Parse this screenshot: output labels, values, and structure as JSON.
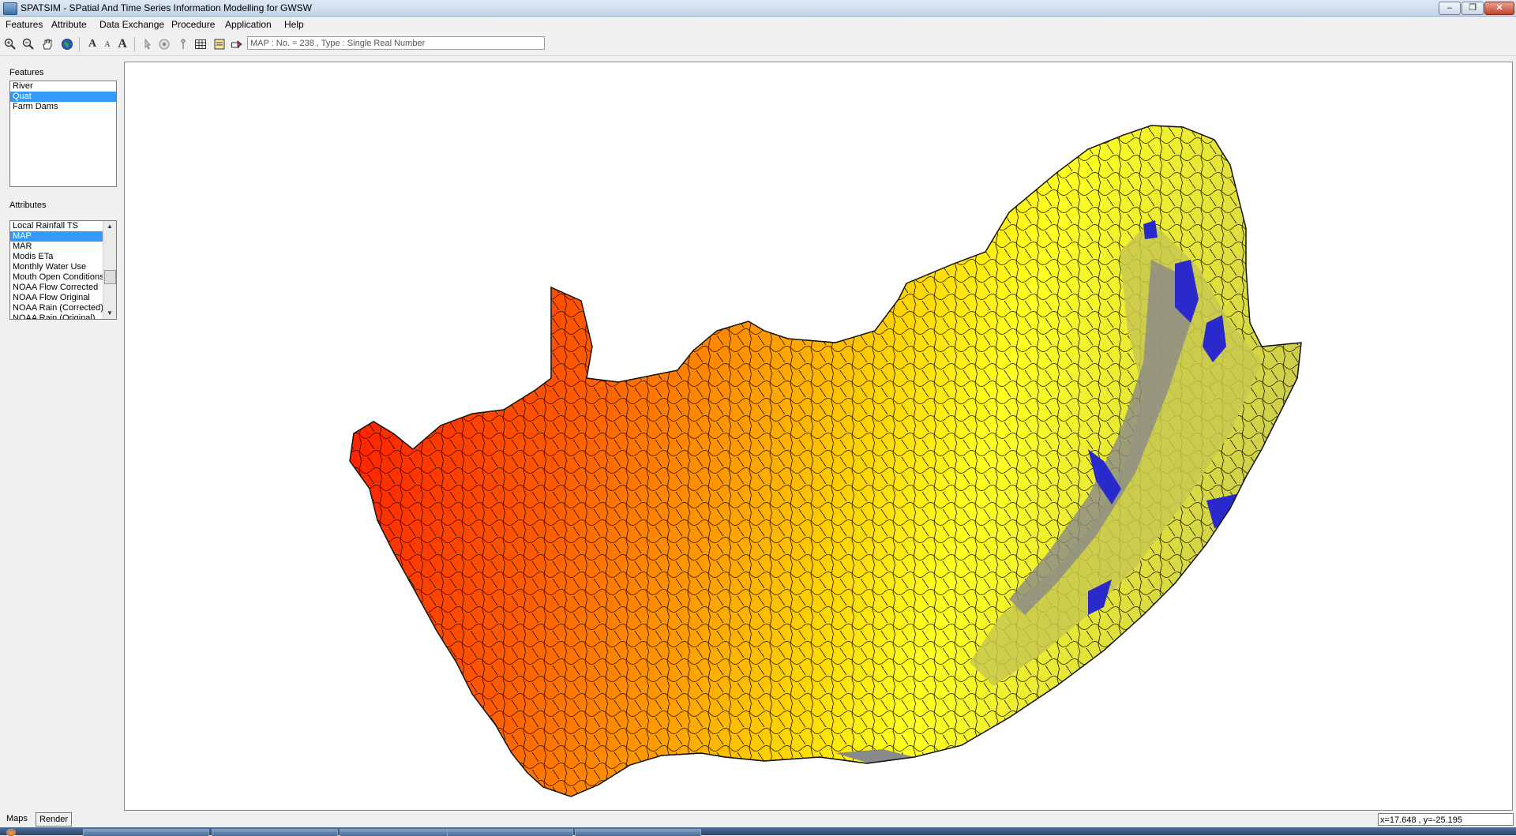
{
  "window": {
    "title": "SPATSIM - SPatial And Time Series Information Modelling for GWSW",
    "controls": {
      "minimize": "–",
      "restore": "❐",
      "close": "✕"
    }
  },
  "menu": [
    {
      "label": "Features"
    },
    {
      "label": "Attribute"
    },
    {
      "label": "Data Exchange"
    },
    {
      "label": "Procedure"
    },
    {
      "label": "Application"
    },
    {
      "label": "Help"
    }
  ],
  "toolbar": {
    "tools": [
      "zoom-in-icon",
      "zoom-out-icon",
      "pan-hand-icon",
      "globe-icon",
      "font-large-icon",
      "font-small-icon",
      "font-bold-icon",
      "pointer-icon",
      "identify-icon",
      "pin-icon",
      "table-icon",
      "properties-icon",
      "export-icon"
    ],
    "status_text": "MAP : No. = 238 , Type : Single Real Number"
  },
  "features_panel": {
    "label": "Features",
    "items": [
      "River",
      "Quat",
      "Farm Dams"
    ],
    "selected": "Quat"
  },
  "attributes_panel": {
    "label": "Attributes",
    "items": [
      "Local Rainfall TS",
      "MAP",
      "MAR",
      "Modis ETa",
      "Monthly Water Use",
      "Mouth Open Conditions",
      "NOAA Flow Corrected",
      "NOAA Flow Original",
      "NOAA Rain (Corrected)",
      "NOAA Rain (Original)"
    ],
    "selected": "MAP"
  },
  "tabs": {
    "maps": "Maps",
    "render": "Render"
  },
  "coords": "x=17.648 , y=-25.195",
  "map": {
    "colors": {
      "very_dry": "#ff1a00",
      "dry": "#ff5a00",
      "mid": "#ff9900",
      "moist": "#ffd200",
      "wet": "#ffff20",
      "very_wet": "#c8c850",
      "grey": "#8a8a8a",
      "blue": "#2a2acc"
    }
  }
}
